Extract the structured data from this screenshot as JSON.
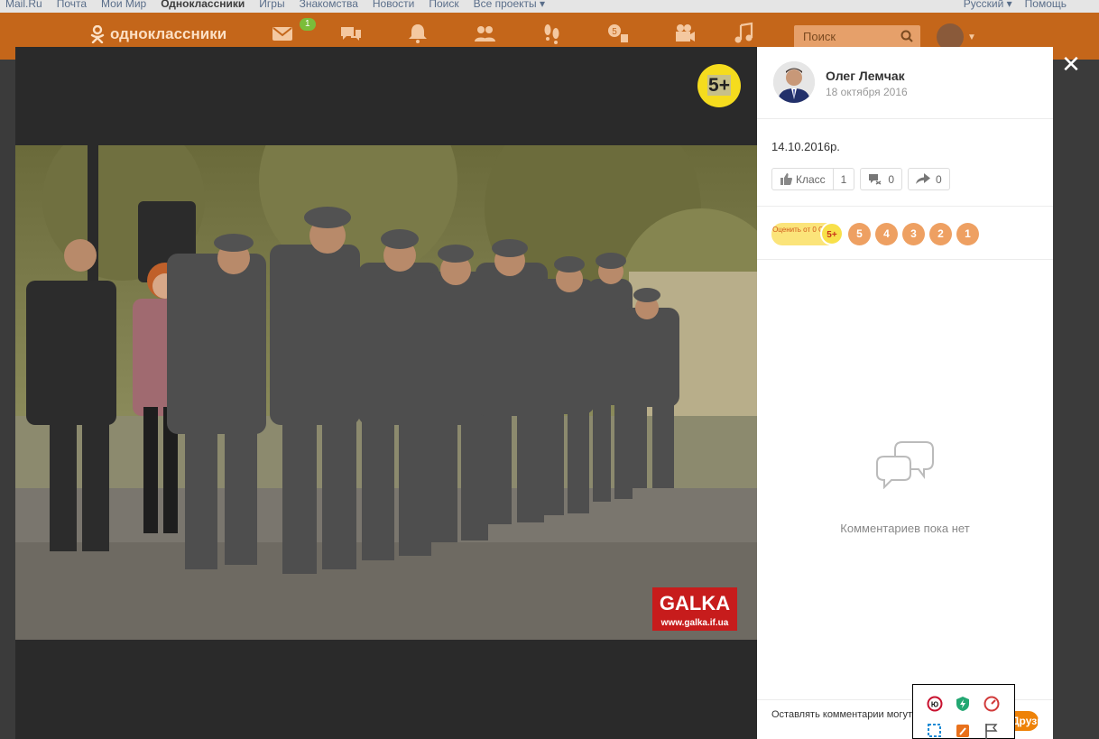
{
  "topbar": {
    "left": [
      "Mail.Ru",
      "Почта",
      "Мои Мир",
      "Одноклассники",
      "Игры",
      "Знакомства",
      "Новости",
      "Поиск",
      "Все проекты ▾"
    ],
    "right": [
      "Русский ▾",
      "Помощь"
    ]
  },
  "header": {
    "logo": "одноклассники",
    "messages_badge": "1",
    "search_placeholder": "Поиск"
  },
  "photo": {
    "age_rating": "5+",
    "watermark_title": "GALKA",
    "watermark_url": "www.galka.if.ua"
  },
  "panel": {
    "author": "Олег Лемчак",
    "date": "18 октября 2016",
    "caption": "14.10.2016р.",
    "like_label": "Класс",
    "like_count": "1",
    "comment_count": "0",
    "share_count": "0",
    "rate_label": "Оценить от 0 ОК",
    "rate_top": "5+",
    "rate_values": [
      "5",
      "4",
      "3",
      "2",
      "1"
    ],
    "no_comments": "Комментариев пока нет",
    "footer_text": "Оставлять комментарии могут только друзья",
    "footer_button": "Друзья"
  },
  "colors": {
    "header_orange": "#c4661a",
    "accent_orange": "#ee8208",
    "age_yellow": "#f5dc1e"
  }
}
